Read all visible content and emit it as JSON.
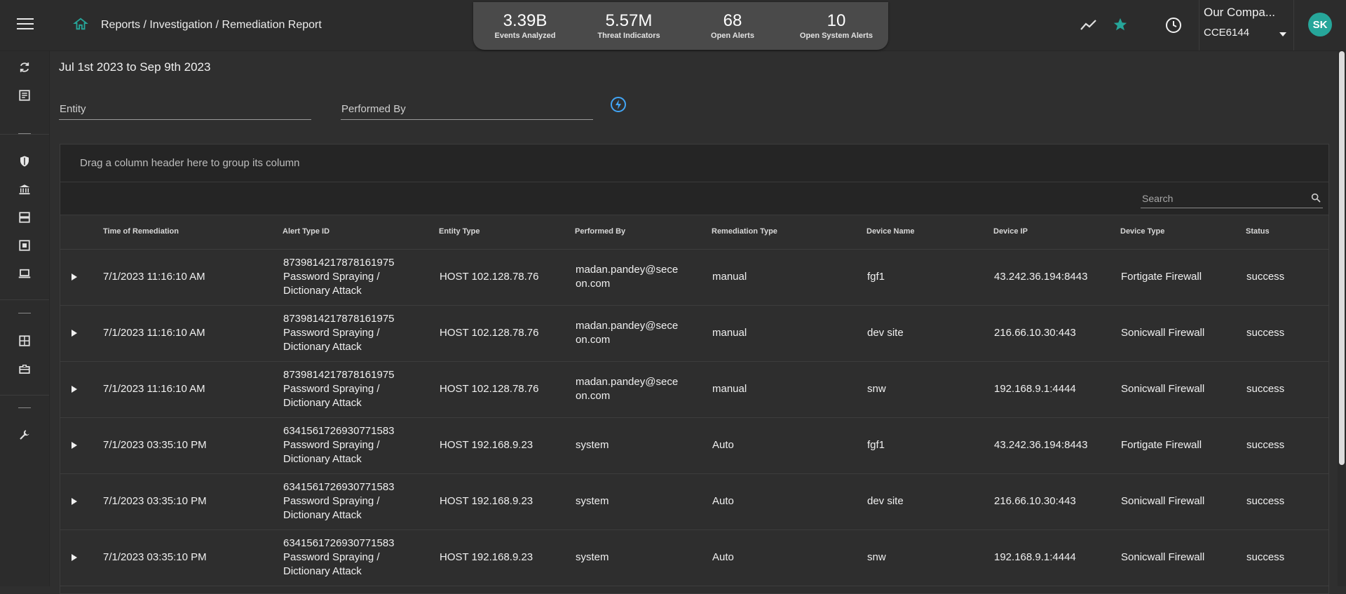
{
  "header": {
    "breadcrumb": "Reports / Investigation / Remediation Report",
    "stats": [
      {
        "value": "3.39B",
        "label": "Events Analyzed"
      },
      {
        "value": "5.57M",
        "label": "Threat Indicators"
      },
      {
        "value": "68",
        "label": "Open Alerts"
      },
      {
        "value": "10",
        "label": "Open System Alerts"
      }
    ],
    "org_name": "Our Compa...",
    "org_code": "CCE6144",
    "avatar_initials": "SK",
    "accent_color": "#26a69a"
  },
  "filters": {
    "date_range": "Jul 1st 2023 to Sep 9th 2023",
    "entity_placeholder": "Entity",
    "performed_by_placeholder": "Performed By"
  },
  "grid": {
    "group_panel_text": "Drag a column header here to group its column",
    "search_placeholder": "Search",
    "columns": [
      "Time of Remediation",
      "Alert Type ID",
      "Entity Type",
      "Performed By",
      "Remediation Type",
      "Device Name",
      "Device IP",
      "Device Type",
      "Status"
    ],
    "rows": [
      {
        "time": "7/1/2023 11:16:10 AM",
        "alert_id": "8739814217878161975",
        "alert_name_1": "Password Spraying /",
        "alert_name_2": "Dictionary Attack",
        "entity": "HOST 102.128.78.76",
        "by_1": "madan.pandey@sece",
        "by_2": "on.com",
        "rtype": "manual",
        "device": "fgf1",
        "ip": "43.242.36.194:8443",
        "dtype": "Fortigate Firewall",
        "status": "success"
      },
      {
        "time": "7/1/2023 11:16:10 AM",
        "alert_id": "8739814217878161975",
        "alert_name_1": "Password Spraying /",
        "alert_name_2": "Dictionary Attack",
        "entity": "HOST 102.128.78.76",
        "by_1": "madan.pandey@sece",
        "by_2": "on.com",
        "rtype": "manual",
        "device": "dev site",
        "ip": "216.66.10.30:443",
        "dtype": "Sonicwall Firewall",
        "status": "success"
      },
      {
        "time": "7/1/2023 11:16:10 AM",
        "alert_id": "8739814217878161975",
        "alert_name_1": "Password Spraying /",
        "alert_name_2": "Dictionary Attack",
        "entity": "HOST 102.128.78.76",
        "by_1": "madan.pandey@sece",
        "by_2": "on.com",
        "rtype": "manual",
        "device": "snw",
        "ip": "192.168.9.1:4444",
        "dtype": "Sonicwall Firewall",
        "status": "success"
      },
      {
        "time": "7/1/2023 03:35:10 PM",
        "alert_id": "6341561726930771583",
        "alert_name_1": "Password Spraying /",
        "alert_name_2": "Dictionary Attack",
        "entity": "HOST 192.168.9.23",
        "by_1": "system",
        "by_2": "",
        "rtype": "Auto",
        "device": "fgf1",
        "ip": "43.242.36.194:8443",
        "dtype": "Fortigate Firewall",
        "status": "success"
      },
      {
        "time": "7/1/2023 03:35:10 PM",
        "alert_id": "6341561726930771583",
        "alert_name_1": "Password Spraying /",
        "alert_name_2": "Dictionary Attack",
        "entity": "HOST 192.168.9.23",
        "by_1": "system",
        "by_2": "",
        "rtype": "Auto",
        "device": "dev site",
        "ip": "216.66.10.30:443",
        "dtype": "Sonicwall Firewall",
        "status": "success"
      },
      {
        "time": "7/1/2023 03:35:10 PM",
        "alert_id": "6341561726930771583",
        "alert_name_1": "Password Spraying /",
        "alert_name_2": "Dictionary Attack",
        "entity": "HOST 192.168.9.23",
        "by_1": "system",
        "by_2": "",
        "rtype": "Auto",
        "device": "snw",
        "ip": "192.168.9.1:4444",
        "dtype": "Sonicwall Firewall",
        "status": "success"
      }
    ]
  }
}
